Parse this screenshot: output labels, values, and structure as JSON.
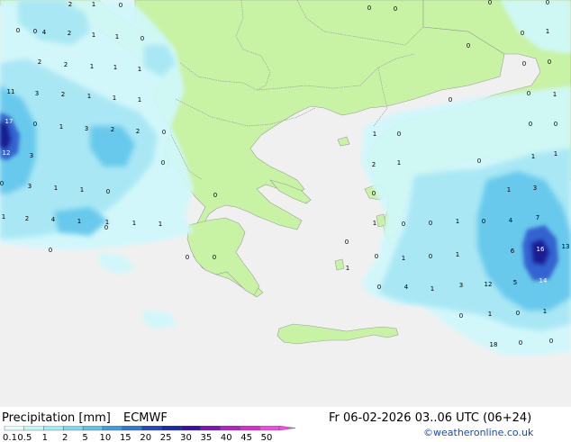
{
  "footer": {
    "title": "Precipitation [mm]",
    "model": "ECMWF",
    "valid": "Fr 06-02-2026 03..06 UTC (06+24)",
    "credit": "©weatheronline.co.uk"
  },
  "legend": {
    "labels": [
      "0.1",
      "0.5",
      "1",
      "2",
      "5",
      "10",
      "15",
      "20",
      "25",
      "30",
      "35",
      "40",
      "45",
      "50"
    ],
    "colors": [
      "#e6fcfc",
      "#c3f6f8",
      "#9eecf4",
      "#7fd9ee",
      "#5fc3e8",
      "#3c9ee0",
      "#2f79d3",
      "#2048b8",
      "#1a2aa0",
      "#3b0fa3",
      "#7a14b8",
      "#b41ecb",
      "#dd28d6",
      "#f04ce0"
    ]
  },
  "colors": {
    "sea": "#f0f0f0",
    "land": "#c8f2a4",
    "border": "#a0a0a0",
    "precip_light": "#d0f8fb",
    "precip_mid": "#a7e7f4",
    "precip_heavy": "#65c8ec",
    "precip_very": "#2e58cc",
    "precip_extreme": "#14148c"
  },
  "map": {
    "values": [
      {
        "v": "2",
        "c": "dark"
      },
      {
        "v": "1",
        "c": "dark"
      },
      {
        "v": "0",
        "c": "dark"
      },
      {
        "v": "0",
        "c": "dark"
      },
      {
        "v": "0",
        "c": "dark"
      },
      {
        "v": "0",
        "c": "dark"
      },
      {
        "v": "4",
        "c": "dark"
      },
      {
        "v": "2",
        "c": "dark"
      },
      {
        "v": "1",
        "c": "dark"
      },
      {
        "v": "1",
        "c": "dark"
      },
      {
        "v": "0",
        "c": "dark"
      },
      {
        "v": "2",
        "c": "dark"
      },
      {
        "v": "2",
        "c": "dark"
      },
      {
        "v": "1",
        "c": "dark"
      },
      {
        "v": "1",
        "c": "dark"
      },
      {
        "v": "1",
        "c": "dark"
      },
      {
        "v": "11",
        "c": "dark"
      },
      {
        "v": "3",
        "c": "dark"
      },
      {
        "v": "2",
        "c": "dark"
      },
      {
        "v": "1",
        "c": "dark"
      },
      {
        "v": "1",
        "c": "dark"
      },
      {
        "v": "1",
        "c": "dark"
      },
      {
        "v": "17",
        "c": "light"
      },
      {
        "v": "0",
        "c": "dark"
      },
      {
        "v": "1",
        "c": "dark"
      },
      {
        "v": "3",
        "c": "dark"
      },
      {
        "v": "2",
        "c": "dark"
      },
      {
        "v": "2",
        "c": "dark"
      },
      {
        "v": "0",
        "c": "dark"
      },
      {
        "v": "12",
        "c": "light"
      },
      {
        "v": "3",
        "c": "dark"
      },
      {
        "v": "0",
        "c": "dark"
      },
      {
        "v": "0",
        "c": "dark"
      },
      {
        "v": "3",
        "c": "dark"
      },
      {
        "v": "1",
        "c": "dark"
      },
      {
        "v": "1",
        "c": "dark"
      },
      {
        "v": "0",
        "c": "dark"
      },
      {
        "v": "1",
        "c": "dark"
      },
      {
        "v": "2",
        "c": "dark"
      },
      {
        "v": "4",
        "c": "dark"
      },
      {
        "v": "1",
        "c": "dark"
      },
      {
        "v": "1",
        "c": "dark"
      },
      {
        "v": "1",
        "c": "dark"
      },
      {
        "v": "1",
        "c": "dark"
      },
      {
        "v": "0",
        "c": "dark"
      },
      {
        "v": "0",
        "c": "dark"
      },
      {
        "v": "0",
        "c": "dark"
      },
      {
        "v": "0",
        "c": "dark"
      },
      {
        "v": "0",
        "c": "dark"
      },
      {
        "v": "0",
        "c": "dark"
      },
      {
        "v": "1",
        "c": "dark"
      },
      {
        "v": "0",
        "c": "dark"
      },
      {
        "v": "0",
        "c": "dark"
      },
      {
        "v": "0",
        "c": "dark"
      },
      {
        "v": "1",
        "c": "dark"
      },
      {
        "v": "0",
        "c": "dark"
      },
      {
        "v": "0",
        "c": "dark"
      },
      {
        "v": "0",
        "c": "dark"
      },
      {
        "v": "1",
        "c": "dark"
      },
      {
        "v": "0",
        "c": "dark"
      },
      {
        "v": "2",
        "c": "dark"
      },
      {
        "v": "1",
        "c": "dark"
      },
      {
        "v": "0",
        "c": "dark"
      },
      {
        "v": "1",
        "c": "dark"
      },
      {
        "v": "1",
        "c": "dark"
      },
      {
        "v": "0",
        "c": "dark"
      },
      {
        "v": "1",
        "c": "dark"
      },
      {
        "v": "0",
        "c": "dark"
      },
      {
        "v": "0",
        "c": "dark"
      },
      {
        "v": "1",
        "c": "dark"
      },
      {
        "v": "0",
        "c": "dark"
      },
      {
        "v": "1",
        "c": "dark"
      },
      {
        "v": "3",
        "c": "dark"
      },
      {
        "v": "4",
        "c": "dark"
      },
      {
        "v": "7",
        "c": "dark"
      },
      {
        "v": "0",
        "c": "dark"
      },
      {
        "v": "0",
        "c": "dark"
      },
      {
        "v": "1",
        "c": "dark"
      },
      {
        "v": "0",
        "c": "dark"
      },
      {
        "v": "1",
        "c": "dark"
      },
      {
        "v": "6",
        "c": "dark"
      },
      {
        "v": "16",
        "c": "light"
      },
      {
        "v": "13",
        "c": "dark"
      },
      {
        "v": "1",
        "c": "dark"
      },
      {
        "v": "0",
        "c": "dark"
      },
      {
        "v": "4",
        "c": "dark"
      },
      {
        "v": "1",
        "c": "dark"
      },
      {
        "v": "3",
        "c": "dark"
      },
      {
        "v": "12",
        "c": "dark"
      },
      {
        "v": "5",
        "c": "dark"
      },
      {
        "v": "14",
        "c": "light"
      },
      {
        "v": "0",
        "c": "dark"
      },
      {
        "v": "1",
        "c": "dark"
      },
      {
        "v": "0",
        "c": "dark"
      },
      {
        "v": "1",
        "c": "dark"
      },
      {
        "v": "18",
        "c": "dark"
      },
      {
        "v": "0",
        "c": "dark"
      },
      {
        "v": "0",
        "c": "dark"
      },
      {
        "v": "0",
        "c": "dark"
      },
      {
        "v": "0",
        "c": "dark"
      },
      {
        "v": "0",
        "c": "dark"
      },
      {
        "v": "0",
        "c": "dark"
      }
    ]
  }
}
